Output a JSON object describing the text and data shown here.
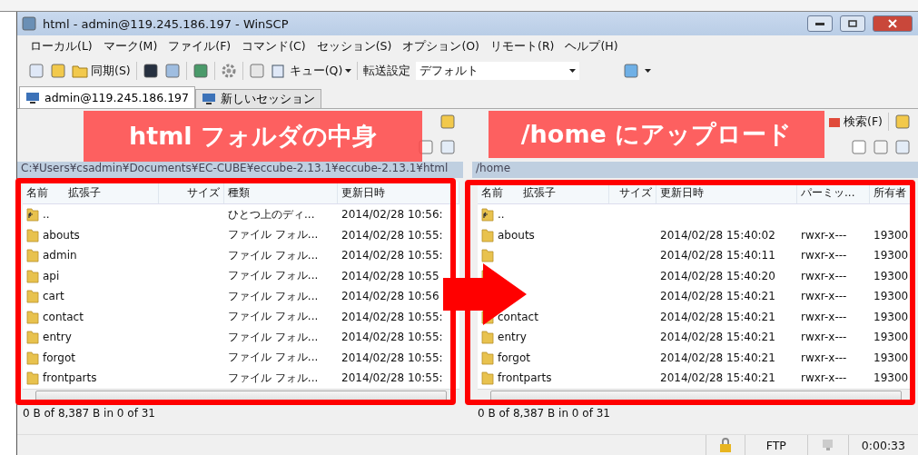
{
  "window": {
    "title": "html - admin@119.245.186.197 - WinSCP"
  },
  "menu": [
    "ローカル(L)",
    "マーク(M)",
    "ファイル(F)",
    "コマンド(C)",
    "セッション(S)",
    "オプション(O)",
    "リモート(R)",
    "ヘルプ(H)"
  ],
  "toolbar": {
    "sync": "同期(S)",
    "queue": "キュー(Q)",
    "transfer_label": "転送設定",
    "transfer_value": "デフォルト"
  },
  "tabs": [
    {
      "label": "admin@119.245.186.197",
      "selected": true
    },
    {
      "label": "新しいセッション",
      "selected": false
    }
  ],
  "left_pane": {
    "path": "C:¥Users¥csadmin¥Documents¥EC-CUBE¥eccube-2.13.1¥eccube-2.13.1¥html",
    "columns": [
      "名前",
      "拡張子",
      "サイズ",
      "種類",
      "更新日時"
    ],
    "rows": [
      {
        "kind": "parent",
        "name": "..",
        "type": "ひとつ上のディ...",
        "modified": "2014/02/28  10:56:"
      },
      {
        "kind": "folder",
        "name": "abouts",
        "type": "ファイル フォル...",
        "modified": "2014/02/28  10:55:"
      },
      {
        "kind": "folder",
        "name": "admin",
        "type": "ファイル フォル...",
        "modified": "2014/02/28  10:55:"
      },
      {
        "kind": "folder",
        "name": "api",
        "type": "ファイル フォル...",
        "modified": "2014/02/28  10:55"
      },
      {
        "kind": "folder",
        "name": "cart",
        "type": "ファイル フォル...",
        "modified": "2014/02/28  10:56"
      },
      {
        "kind": "folder",
        "name": "contact",
        "type": "ファイル フォル...",
        "modified": "2014/02/28  10:55:"
      },
      {
        "kind": "folder",
        "name": "entry",
        "type": "ファイル フォル...",
        "modified": "2014/02/28  10:55:"
      },
      {
        "kind": "folder",
        "name": "forgot",
        "type": "ファイル フォル...",
        "modified": "2014/02/28  10:55:"
      },
      {
        "kind": "folder",
        "name": "frontparts",
        "type": "ファイル フォル...",
        "modified": "2014/02/28  10:55:"
      }
    ],
    "status": "0 B of 8,387 B in 0 of 31"
  },
  "right_pane": {
    "search": "検索(F)",
    "path": "/home",
    "columns": [
      "名前",
      "拡張子",
      "サイズ",
      "更新日時",
      "パーミッ...",
      "所有者"
    ],
    "rows": [
      {
        "kind": "parent",
        "name": ".."
      },
      {
        "kind": "folder",
        "name": "abouts",
        "modified": "2014/02/28 15:40:02",
        "permissions": "rwxr-x---",
        "owner": "19300"
      },
      {
        "kind": "folder",
        "modified": "2014/02/28 15:40:11",
        "permissions": "rwxr-x---",
        "owner": "19300"
      },
      {
        "kind": "folder",
        "modified": "2014/02/28 15:40:20",
        "permissions": "rwxr-x---",
        "owner": "19300"
      },
      {
        "kind": "folder",
        "modified": "2014/02/28 15:40:21",
        "permissions": "rwxr-x---",
        "owner": "19300"
      },
      {
        "kind": "folder",
        "name": "contact",
        "modified": "2014/02/28 15:40:21",
        "permissions": "rwxr-x---",
        "owner": "19300"
      },
      {
        "kind": "folder",
        "name": "entry",
        "modified": "2014/02/28 15:40:21",
        "permissions": "rwxr-x---",
        "owner": "19300"
      },
      {
        "kind": "folder",
        "name": "forgot",
        "modified": "2014/02/28 15:40:21",
        "permissions": "rwxr-x---",
        "owner": "19300"
      },
      {
        "kind": "folder",
        "name": "frontparts",
        "modified": "2014/02/28 15:40:21",
        "permissions": "rwxr-x---",
        "owner": "19300"
      }
    ],
    "status": "0 B of 8,387 B in 0 of 31"
  },
  "status_bar": {
    "protocol": "FTP",
    "elapsed": "0:00:33"
  },
  "annotations": {
    "left_label": "html フォルダの中身",
    "right_label": "/home にアップロード"
  }
}
